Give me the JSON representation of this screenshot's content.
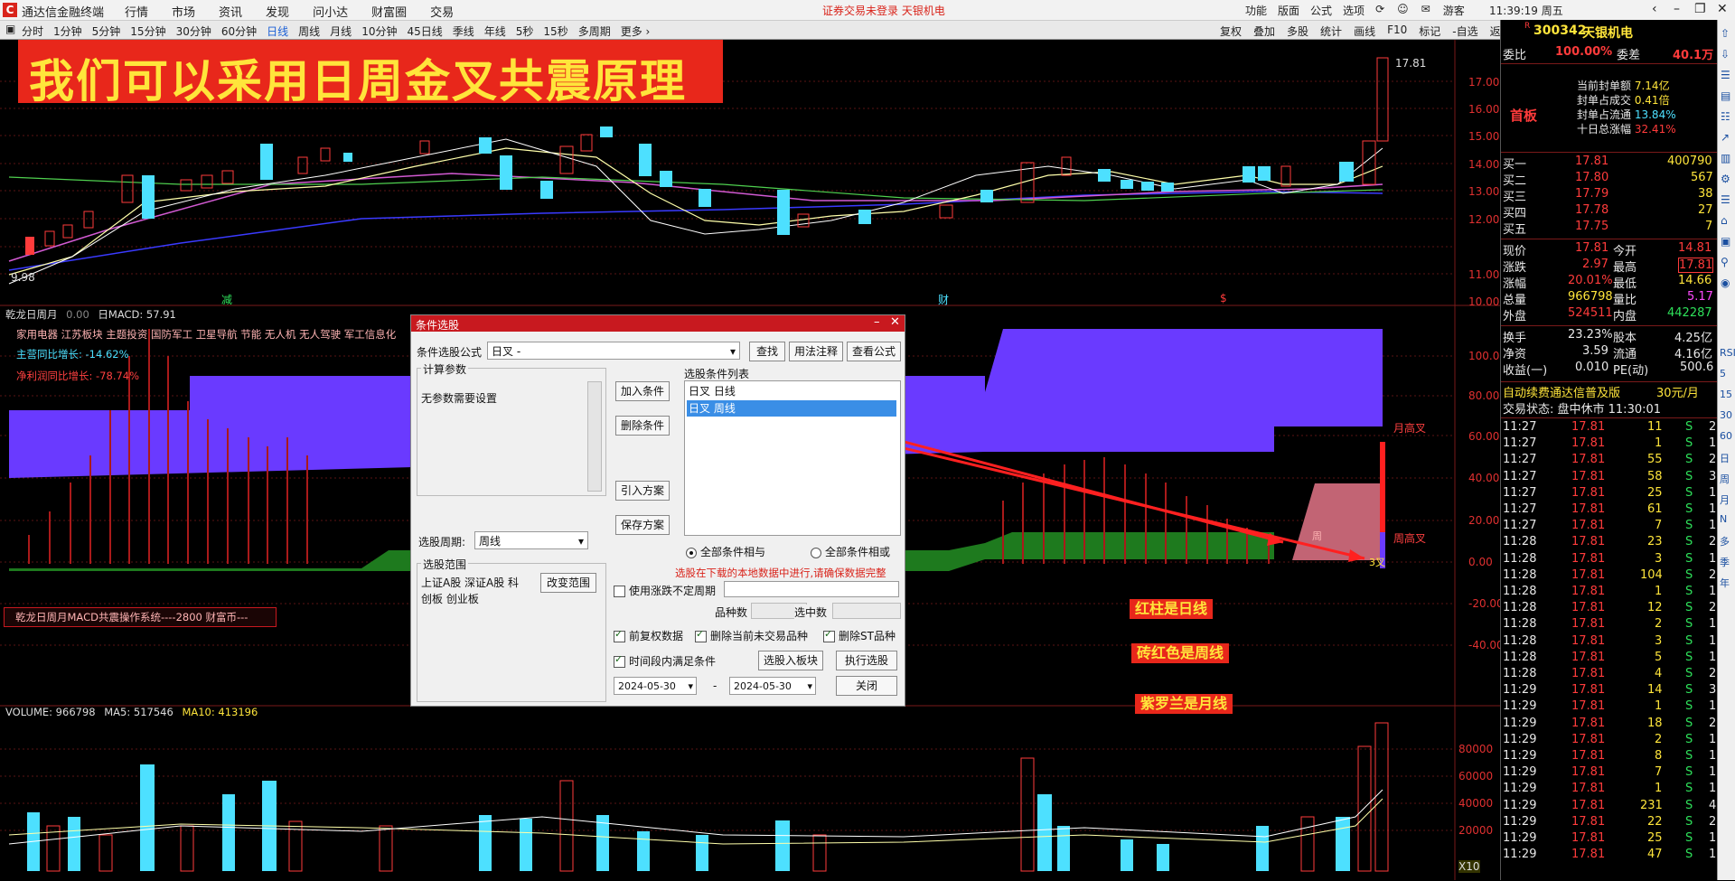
{
  "titlebar": {
    "app_name": "通达信金融终端",
    "menu": [
      "行情",
      "市场",
      "资讯",
      "发现",
      "问小达",
      "财富圈",
      "交易"
    ],
    "notice": "证券交易未登录  天银机电",
    "right_menu": [
      "功能",
      "版面",
      "公式",
      "选项",
      "",
      "",
      "",
      "游客"
    ],
    "clock": "11:39:19 周五"
  },
  "toolbar": {
    "periods": [
      "分时",
      "1分钟",
      "5分钟",
      "15分钟",
      "30分钟",
      "60分钟",
      "日线",
      "周线",
      "月线",
      "10分钟",
      "45日线",
      "季线",
      "年线",
      "5秒",
      "15秒",
      "多周期",
      "更多 ›"
    ],
    "active_period": "日线",
    "tools": [
      "复权",
      "叠加",
      "多股",
      "统计",
      "画线",
      "F10",
      "标记",
      "-自选",
      "返回"
    ]
  },
  "headline": "我们可以采用日周金叉共震原理",
  "price_axis": [
    "17.00",
    "16.00",
    "15.00",
    "14.00",
    "13.00",
    "12.00",
    "11.00",
    "10.00"
  ],
  "price_high": "17.81",
  "price_low": "9.98",
  "markers": {
    "m1": "减",
    "m2": "财",
    "m3": "$"
  },
  "indicator": {
    "title": "乾龙日周月",
    "value1": "0.00",
    "macd": "日MACD: 57.91",
    "sectors": "家用电器 江苏板块 主题投资 国防军工 卫星导航 节能 无人机 无人驾驶 军工信息化",
    "revenue_growth_label": "主营同比增长:",
    "revenue_growth": "-14.62%",
    "profit_growth_label": "净利润同比增长:",
    "profit_growth": "-78.74%",
    "system_label": "乾龙日周月MACD共震操作系统----2800 财富币---",
    "axis": [
      "100.00",
      "80.00",
      "60.00",
      "40.00",
      "20.00",
      "0.00",
      "-20.00",
      "-40.00"
    ],
    "month_label": "月高叉",
    "week_label": "周高叉",
    "day_cross": "3叉",
    "week_cross": "周"
  },
  "notes": {
    "red_bar": "红柱是日线",
    "brick_red": "砖红色是周线",
    "violet": "紫罗兰是月线"
  },
  "volume": {
    "label": "VOLUME: 966798",
    "ma5": "MA5: 517546",
    "ma10": "MA10: 413196",
    "axis": [
      "80000",
      "60000",
      "40000",
      "20000"
    ],
    "unit": "X10"
  },
  "dialog": {
    "title": "条件选股",
    "formula_label": "条件选股公式",
    "formula_value": "日叉  -",
    "btn_find": "查找",
    "btn_usage": "用法注释",
    "btn_view": "查看公式",
    "calc_params_label": "计算参数",
    "no_params": "无参数需要设置",
    "period_label": "选股周期:",
    "period_value": "周线",
    "scope_label": "选股范围",
    "scope_value": "上证A股 深证A股 科创板 创业板",
    "btn_change_scope": "改变范围",
    "btn_add": "加入条件",
    "btn_delete": "删除条件",
    "btn_import": "引入方案",
    "btn_save": "保存方案",
    "cond_list_label": "选股条件列表",
    "conditions": [
      "日叉  日线",
      "日叉  周线"
    ],
    "radio_and": "全部条件相与",
    "radio_or": "全部条件相或",
    "warn": "选股在下载的本地数据中进行,请确保数据完整",
    "chk_uncertain": "使用涨跌不定周期",
    "count_label": "品种数",
    "selected_label": "选中数",
    "chk_prev_adj": "前复权数据",
    "chk_del_untraded": "删除当前未交易品种",
    "chk_del_st": "删除ST品种",
    "chk_time_range": "时间段内满足条件",
    "btn_to_block": "选股入板块",
    "btn_run": "执行选股",
    "date_from": "2024-05-30",
    "date_to": "2024-05-30",
    "btn_close": "关闭"
  },
  "quote": {
    "code": "300342",
    "name": "天银机电",
    "flag": "R",
    "weibi_label": "委比",
    "weibi": "100.00%",
    "weicha_label": "委差",
    "weicha": "40.1万",
    "board": "首板",
    "seal_lines": [
      {
        "label": "当前封单额",
        "value": "7.14亿"
      },
      {
        "label": "封单占成交",
        "value": "0.41倍"
      },
      {
        "label": "封单占流通",
        "value": "13.84%"
      },
      {
        "label": "十日总涨幅",
        "value": "32.41%"
      }
    ],
    "bids": [
      {
        "label": "买一",
        "price": "17.81",
        "vol": "400790"
      },
      {
        "label": "买二",
        "price": "17.80",
        "vol": "567"
      },
      {
        "label": "买三",
        "price": "17.79",
        "vol": "38"
      },
      {
        "label": "买四",
        "price": "17.78",
        "vol": "27"
      },
      {
        "label": "买五",
        "price": "17.75",
        "vol": "7"
      }
    ],
    "stats": [
      {
        "l1": "现价",
        "v1": "17.81",
        "l2": "今开",
        "v2": "14.81"
      },
      {
        "l1": "涨跌",
        "v1": "2.97",
        "l2": "最高",
        "v2": "17.81"
      },
      {
        "l1": "涨幅",
        "v1": "20.01%",
        "l2": "最低",
        "v2": "14.66"
      },
      {
        "l1": "总量",
        "v1": "966798",
        "l2": "量比",
        "v2": "5.17"
      },
      {
        "l1": "外盘",
        "v1": "524511",
        "l2": "内盘",
        "v2": "442287"
      },
      {
        "l1": "换手",
        "v1": "23.23%",
        "l2": "股本",
        "v2": "4.25亿"
      },
      {
        "l1": "净资",
        "v1": "3.59",
        "l2": "流通",
        "v2": "4.16亿"
      },
      {
        "l1": "收益(一)",
        "v1": "0.010",
        "l2": "PE(动)",
        "v2": "500.6"
      }
    ],
    "promo": "自动续费通达信普及版",
    "promo_price": "30元/月",
    "status": "交易状态: 盘中休市 11:30:01",
    "ticks": [
      {
        "t": "11:27",
        "p": "17.81",
        "v": "11",
        "s": "S",
        "n": "2"
      },
      {
        "t": "11:27",
        "p": "17.81",
        "v": "1",
        "s": "S",
        "n": "1"
      },
      {
        "t": "11:27",
        "p": "17.81",
        "v": "55",
        "s": "S",
        "n": "2"
      },
      {
        "t": "11:27",
        "p": "17.81",
        "v": "58",
        "s": "S",
        "n": "3"
      },
      {
        "t": "11:27",
        "p": "17.81",
        "v": "25",
        "s": "S",
        "n": "1"
      },
      {
        "t": "11:27",
        "p": "17.81",
        "v": "61",
        "s": "S",
        "n": "1"
      },
      {
        "t": "11:27",
        "p": "17.81",
        "v": "7",
        "s": "S",
        "n": "1"
      },
      {
        "t": "11:28",
        "p": "17.81",
        "v": "23",
        "s": "S",
        "n": "2"
      },
      {
        "t": "11:28",
        "p": "17.81",
        "v": "3",
        "s": "S",
        "n": "1"
      },
      {
        "t": "11:28",
        "p": "17.81",
        "v": "104",
        "s": "S",
        "n": "2"
      },
      {
        "t": "11:28",
        "p": "17.81",
        "v": "1",
        "s": "S",
        "n": "1"
      },
      {
        "t": "11:28",
        "p": "17.81",
        "v": "12",
        "s": "S",
        "n": "2"
      },
      {
        "t": "11:28",
        "p": "17.81",
        "v": "2",
        "s": "S",
        "n": "1"
      },
      {
        "t": "11:28",
        "p": "17.81",
        "v": "3",
        "s": "S",
        "n": "1"
      },
      {
        "t": "11:28",
        "p": "17.81",
        "v": "5",
        "s": "S",
        "n": "1"
      },
      {
        "t": "11:28",
        "p": "17.81",
        "v": "4",
        "s": "S",
        "n": "2"
      },
      {
        "t": "11:29",
        "p": "17.81",
        "v": "14",
        "s": "S",
        "n": "3"
      },
      {
        "t": "11:29",
        "p": "17.81",
        "v": "1",
        "s": "S",
        "n": "1"
      },
      {
        "t": "11:29",
        "p": "17.81",
        "v": "18",
        "s": "S",
        "n": "2"
      },
      {
        "t": "11:29",
        "p": "17.81",
        "v": "2",
        "s": "S",
        "n": "1"
      },
      {
        "t": "11:29",
        "p": "17.81",
        "v": "8",
        "s": "S",
        "n": "1"
      },
      {
        "t": "11:29",
        "p": "17.81",
        "v": "7",
        "s": "S",
        "n": "1"
      },
      {
        "t": "11:29",
        "p": "17.81",
        "v": "1",
        "s": "S",
        "n": "1"
      },
      {
        "t": "11:29",
        "p": "17.81",
        "v": "231",
        "s": "S",
        "n": "4"
      },
      {
        "t": "11:29",
        "p": "17.81",
        "v": "22",
        "s": "S",
        "n": "2"
      },
      {
        "t": "11:29",
        "p": "17.81",
        "v": "25",
        "s": "S",
        "n": "1"
      },
      {
        "t": "11:29",
        "p": "17.81",
        "v": "47",
        "s": "S",
        "n": "1"
      }
    ]
  },
  "sidebar_labels": [
    "RSI",
    "5",
    "15",
    "30",
    "60",
    "日",
    "周",
    "月",
    "N",
    "多",
    "季",
    "年"
  ]
}
